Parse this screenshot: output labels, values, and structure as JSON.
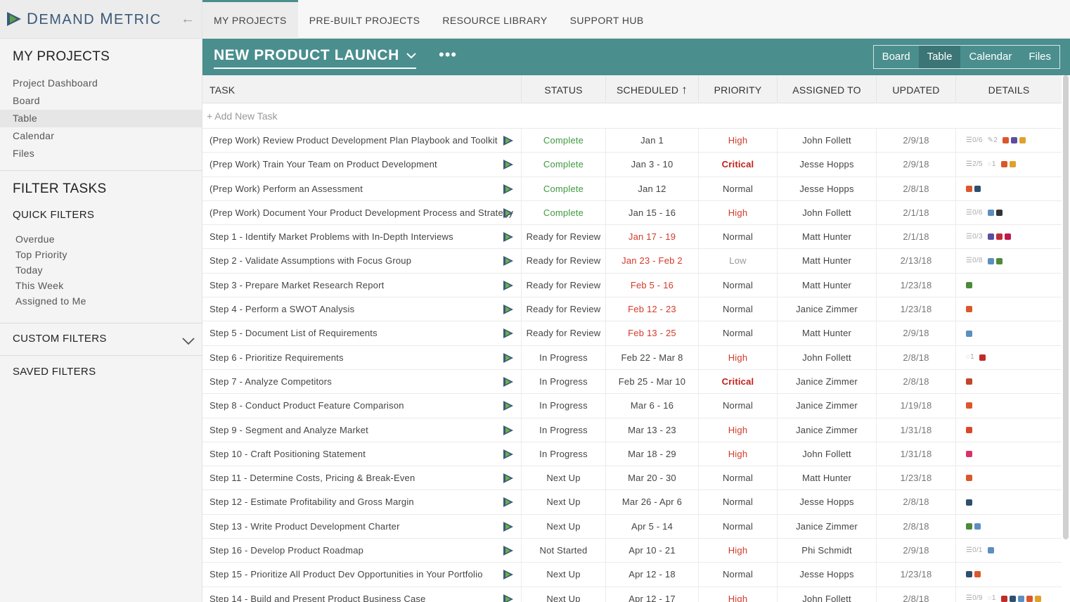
{
  "logo": {
    "word1_cap": "D",
    "word1_rest": "EMAND",
    "word2_cap": "M",
    "word2_rest": "ETRIC"
  },
  "sidebar": {
    "my_projects_title": "MY PROJECTS",
    "links": [
      "Project Dashboard",
      "Board",
      "Table",
      "Calendar",
      "Files"
    ],
    "filter_title": "FILTER TASKS",
    "quick_filters_title": "QUICK FILTERS",
    "quick_filters": [
      "Overdue",
      "Top Priority",
      "Today",
      "This Week",
      "Assigned to Me"
    ],
    "custom_filters": "CUSTOM FILTERS",
    "saved_filters": "SAVED FILTERS"
  },
  "topnav": [
    "MY PROJECTS",
    "PRE-BUILT PROJECTS",
    "RESOURCE LIBRARY",
    "SUPPORT HUB"
  ],
  "project": {
    "title": "NEW PRODUCT LAUNCH",
    "more": "•••",
    "views": [
      "Board",
      "Table",
      "Calendar",
      "Files"
    ]
  },
  "table": {
    "headers": [
      "TASK",
      "STATUS",
      "SCHEDULED",
      "PRIORITY",
      "ASSIGNED TO",
      "UPDATED",
      "DETAILS"
    ],
    "add_task": "+ Add New Task",
    "rows": [
      {
        "task": "(Prep Work) Review Product Development Plan Playbook and Toolkit",
        "status": "Complete",
        "sched": "Jan 1",
        "late": false,
        "prio": "High",
        "assign": "John Follett",
        "upd": "2/9/18",
        "meta": [
          "☰0/6",
          "✎2"
        ],
        "dots": [
          "#d9582b",
          "#5b4ea0",
          "#e0a12a"
        ]
      },
      {
        "task": "(Prep Work) Train Your Team on Product Development",
        "status": "Complete",
        "sched": "Jan 3 - 10",
        "late": false,
        "prio": "Critical",
        "assign": "Jesse Hopps",
        "upd": "2/9/18",
        "meta": [
          "☰2/5",
          "◌1"
        ],
        "dots": [
          "#d9582b",
          "#e0a12a"
        ]
      },
      {
        "task": "(Prep Work) Perform an Assessment",
        "status": "Complete",
        "sched": "Jan 12",
        "late": false,
        "prio": "Normal",
        "assign": "Jesse Hopps",
        "upd": "2/8/18",
        "meta": [],
        "dots": [
          "#d9582b",
          "#2f4f6f"
        ]
      },
      {
        "task": "(Prep Work) Document Your Product Development Process and Strategy",
        "status": "Complete",
        "sched": "Jan 15 - 16",
        "late": false,
        "prio": "High",
        "assign": "John Follett",
        "upd": "2/1/18",
        "meta": [
          "☰0/6"
        ],
        "dots": [
          "#5a8fc0",
          "#333333"
        ]
      },
      {
        "task": "Step 1 - Identify Market Problems with In-Depth Interviews",
        "status": "Ready for Review",
        "sched": "Jan 17 - 19",
        "late": true,
        "prio": "Normal",
        "assign": "Matt Hunter",
        "upd": "2/1/18",
        "meta": [
          "☰0/3"
        ],
        "dots": [
          "#5b4ea0",
          "#c02b3a",
          "#c0184a"
        ]
      },
      {
        "task": "Step 2 - Validate Assumptions with Focus Group",
        "status": "Ready for Review",
        "sched": "Jan 23 - Feb 2",
        "late": true,
        "prio": "Low",
        "assign": "Matt Hunter",
        "upd": "2/13/18",
        "meta": [
          "☰0/8"
        ],
        "dots": [
          "#5a8fc0",
          "#4d8a3a"
        ]
      },
      {
        "task": "Step 3 - Prepare Market Research Report",
        "status": "Ready for Review",
        "sched": "Feb 5 - 16",
        "late": true,
        "prio": "Normal",
        "assign": "Matt Hunter",
        "upd": "1/23/18",
        "meta": [],
        "dots": [
          "#4d8a3a"
        ]
      },
      {
        "task": "Step 4 - Perform a SWOT Analysis",
        "status": "Ready for Review",
        "sched": "Feb 12 - 23",
        "late": true,
        "prio": "Normal",
        "assign": "Janice Zimmer",
        "upd": "1/23/18",
        "meta": [],
        "dots": [
          "#d9582b"
        ]
      },
      {
        "task": "Step 5 - Document List of Requirements",
        "status": "Ready for Review",
        "sched": "Feb 13 - 25",
        "late": true,
        "prio": "Normal",
        "assign": "Matt Hunter",
        "upd": "2/9/18",
        "meta": [],
        "dots": [
          "#5a8fc0"
        ]
      },
      {
        "task": "Step 6 - Prioritize Requirements",
        "status": "In Progress",
        "sched": "Feb 22 - Mar 8",
        "late": false,
        "prio": "High",
        "assign": "John Follett",
        "upd": "2/8/18",
        "meta": [
          "◌1"
        ],
        "dots": [
          "#c02b2a"
        ]
      },
      {
        "task": "Step 7 - Analyze Competitors",
        "status": "In Progress",
        "sched": "Feb 25 - Mar 10",
        "late": false,
        "prio": "Critical",
        "assign": "Janice Zimmer",
        "upd": "2/8/18",
        "meta": [],
        "dots": [
          "#c2462a"
        ]
      },
      {
        "task": "Step 8 - Conduct Product Feature Comparison",
        "status": "In Progress",
        "sched": "Mar 6 - 16",
        "late": false,
        "prio": "Normal",
        "assign": "Janice Zimmer",
        "upd": "1/19/18",
        "meta": [],
        "dots": [
          "#d9582b"
        ]
      },
      {
        "task": "Step 9 - Segment and Analyze Market",
        "status": "In Progress",
        "sched": "Mar 13 - 23",
        "late": false,
        "prio": "High",
        "assign": "Janice Zimmer",
        "upd": "1/31/18",
        "meta": [],
        "dots": [
          "#d9482b"
        ]
      },
      {
        "task": "Step 10 - Craft Positioning Statement",
        "status": "In Progress",
        "sched": "Mar 18 - 29",
        "late": false,
        "prio": "High",
        "assign": "John Follett",
        "upd": "1/31/18",
        "meta": [],
        "dots": [
          "#d6336c"
        ]
      },
      {
        "task": "Step 11 - Determine Costs, Pricing & Break-Even",
        "status": "Next Up",
        "sched": "Mar 20 - 30",
        "late": false,
        "prio": "Normal",
        "assign": "Matt Hunter",
        "upd": "1/23/18",
        "meta": [],
        "dots": [
          "#d9582b"
        ]
      },
      {
        "task": "Step 12 - Estimate Profitability and Gross Margin",
        "status": "Next Up",
        "sched": "Mar 26 - Apr 6",
        "late": false,
        "prio": "Normal",
        "assign": "Jesse Hopps",
        "upd": "2/8/18",
        "meta": [],
        "dots": [
          "#2f4f6f"
        ]
      },
      {
        "task": "Step 13 - Write Product Development Charter",
        "status": "Next Up",
        "sched": "Apr 5 - 14",
        "late": false,
        "prio": "Normal",
        "assign": "Janice Zimmer",
        "upd": "2/8/18",
        "meta": [],
        "dots": [
          "#4d8a3a",
          "#5a8fc0"
        ]
      },
      {
        "task": "Step 16 - Develop Product Roadmap",
        "status": "Not Started",
        "sched": "Apr 10 - 21",
        "late": false,
        "prio": "High",
        "assign": "Phi Schmidt",
        "upd": "2/9/18",
        "meta": [
          "☰0/1"
        ],
        "dots": [
          "#5a8fc0"
        ]
      },
      {
        "task": "Step 15 - Prioritize All Product Dev Opportunities in Your Portfolio",
        "status": "Next Up",
        "sched": "Apr 12 - 18",
        "late": false,
        "prio": "Normal",
        "assign": "Jesse Hopps",
        "upd": "1/23/18",
        "meta": [],
        "dots": [
          "#2f4f6f",
          "#d9582b"
        ]
      },
      {
        "task": "Step 14 - Build and Present Product Business Case",
        "status": "Next Up",
        "sched": "Apr 12 - 17",
        "late": false,
        "prio": "High",
        "assign": "John Follett",
        "upd": "2/8/18",
        "meta": [
          "☰0/9",
          "◌1"
        ],
        "dots": [
          "#c02b2a",
          "#2f4f6f",
          "#5a8fc0",
          "#d9582b",
          "#e0a12a"
        ]
      }
    ]
  }
}
